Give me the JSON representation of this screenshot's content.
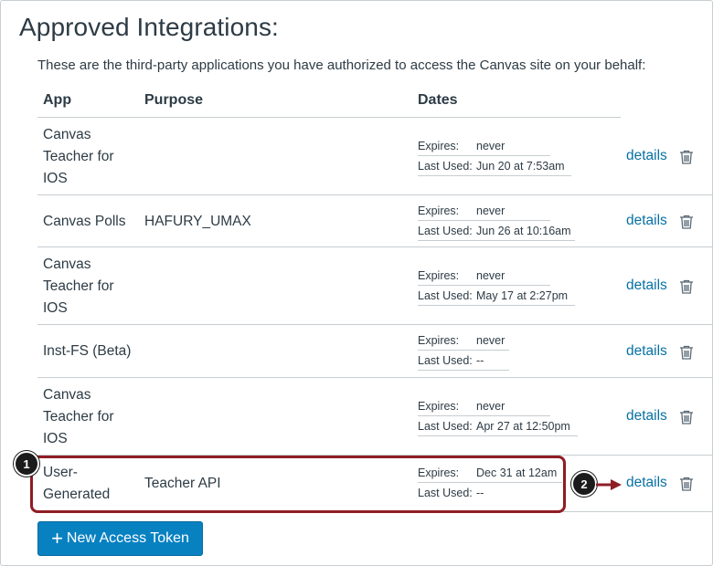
{
  "page": {
    "title": "Approved Integrations:",
    "intro": "These are the third-party applications you have authorized to access the Canvas site on your behalf:"
  },
  "table": {
    "headers": {
      "app": "App",
      "purpose": "Purpose",
      "dates": "Dates"
    },
    "expires_label": "Expires:",
    "last_used_label": "Last Used:",
    "details_label": "details",
    "rows": [
      {
        "app": "Canvas Teacher for IOS",
        "purpose": "",
        "expires": "never",
        "last_used": "Jun 20 at 7:53am"
      },
      {
        "app": "Canvas Polls",
        "purpose": "HAFURY_UMAX",
        "expires": "never",
        "last_used": "Jun 26 at 10:16am"
      },
      {
        "app": "Canvas Teacher for IOS",
        "purpose": "",
        "expires": "never",
        "last_used": "May 17 at 2:27pm"
      },
      {
        "app": "Inst-FS (Beta)",
        "purpose": "",
        "expires": "never",
        "last_used": "--"
      },
      {
        "app": "Canvas Teacher for IOS",
        "purpose": "",
        "expires": "never",
        "last_used": "Apr 27 at 12:50pm"
      },
      {
        "app": "User-Generated",
        "purpose": "Teacher API",
        "expires": "Dec 31 at 12am",
        "last_used": "--"
      }
    ]
  },
  "callouts": {
    "badge1": "1",
    "badge2": "2",
    "color": "#8f1d24"
  },
  "actions": {
    "new_token_label": "New Access Token",
    "new_token_icon": "plus-icon"
  },
  "colors": {
    "link": "#0770a3",
    "button": "#0881c1",
    "text": "#2d3b45",
    "border": "#c7cdd1"
  }
}
